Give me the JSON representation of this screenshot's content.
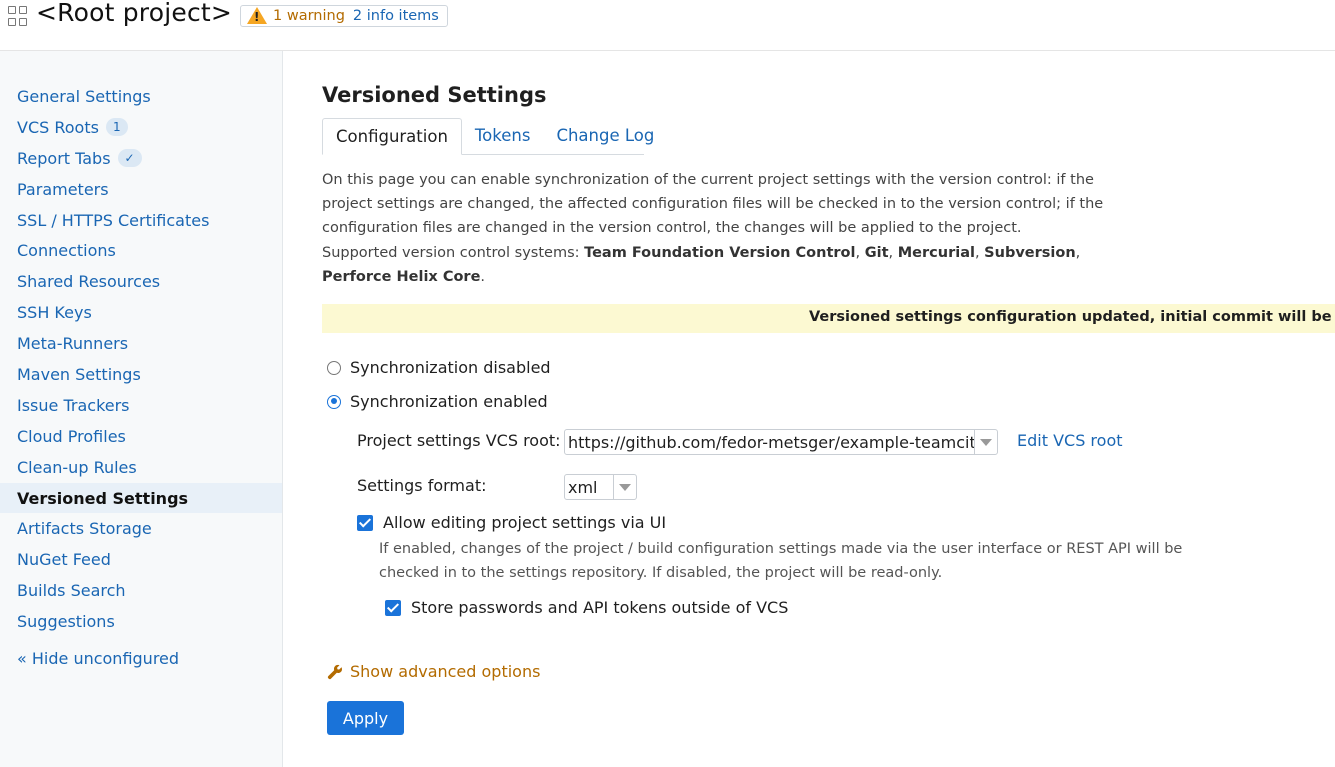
{
  "header": {
    "title": "<Root project>",
    "warning_text": "1 warning",
    "info_text": "2 info items"
  },
  "sidebar": {
    "items": [
      {
        "label": "General Settings"
      },
      {
        "label": "VCS Roots",
        "count": "1"
      },
      {
        "label": "Report Tabs",
        "count": "✓"
      },
      {
        "label": "Parameters"
      },
      {
        "label": "SSL / HTTPS Certificates"
      },
      {
        "label": "Connections"
      },
      {
        "label": "Shared Resources"
      },
      {
        "label": "SSH Keys"
      },
      {
        "label": "Meta-Runners"
      },
      {
        "label": "Maven Settings"
      },
      {
        "label": "Issue Trackers"
      },
      {
        "label": "Cloud Profiles"
      },
      {
        "label": "Clean-up Rules"
      },
      {
        "label": "Versioned Settings",
        "active": true
      },
      {
        "label": "Artifacts Storage"
      },
      {
        "label": "NuGet Feed"
      },
      {
        "label": "Builds Search"
      },
      {
        "label": "Suggestions"
      }
    ],
    "hide_unconfigured": "« Hide unconfigured"
  },
  "main": {
    "title": "Versioned Settings",
    "tabs": [
      {
        "label": "Configuration",
        "active": true
      },
      {
        "label": "Tokens"
      },
      {
        "label": "Change Log"
      }
    ],
    "description": "On this page you can enable synchronization of the current project settings with the version control: if the project settings are changed, the affected configuration files will be checked in to the version control; if the configuration files are changed in the version control, the changes will be applied to the project.",
    "supported_prefix": "Supported version control systems: ",
    "supported_systems": [
      "Team Foundation Version Control",
      "Git",
      "Mercurial",
      "Subversion",
      "Perforce Helix Core"
    ],
    "notice": "Versioned settings configuration updated, initial commit will be made shortly",
    "sync_disabled_label": "Synchronization disabled",
    "sync_enabled_label": "Synchronization enabled",
    "sync_selected": "enabled",
    "vcs_root_label": "Project settings VCS root:",
    "vcs_root_value": "https://github.com/fedor-metsger/example-teamcity",
    "edit_vcs_root": "Edit VCS root",
    "settings_format_label": "Settings format:",
    "settings_format_value": "xml",
    "allow_editing_label": "Allow editing project settings via UI",
    "allow_editing_help": "If enabled, changes of the project / build configuration settings made via the user interface or REST API will be checked in to the settings repository. If disabled, the project will be read-only.",
    "store_passwords_label": "Store passwords and API tokens outside of VCS",
    "advanced_options": "Show advanced options",
    "apply_label": "Apply"
  },
  "colors": {
    "link": "#1a66b3",
    "accent": "#1a73d9",
    "warning": "#f5a623",
    "notice_bg": "#fcf9d2",
    "sidebar_bg": "#f7f9fa"
  }
}
